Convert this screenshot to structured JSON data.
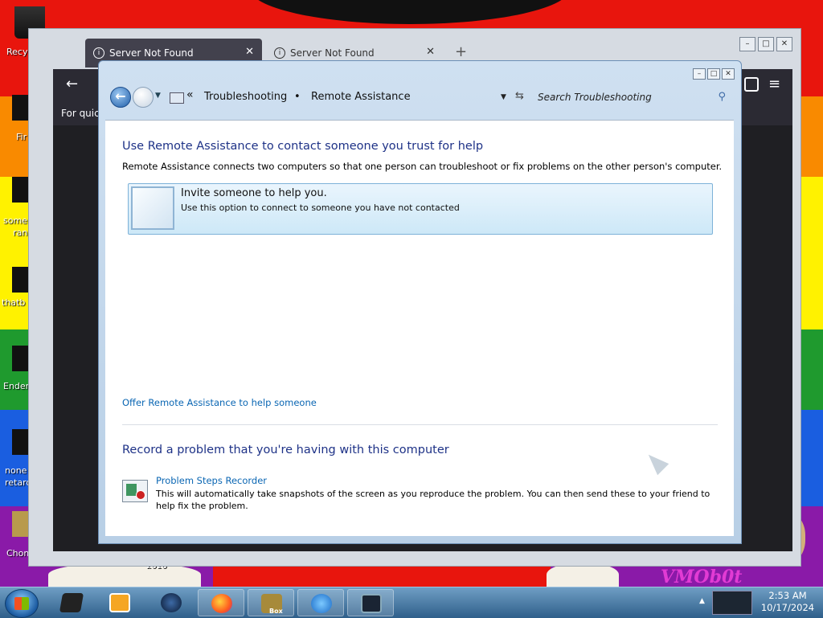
{
  "desktop": {
    "icons": [
      {
        "label": "Recy",
        "icon": "recycle-bin-icon"
      },
      {
        "label": "Fir",
        "icon": "firefox-shortcut-icon"
      },
      {
        "label": "some",
        "label2": "ran",
        "icon": "file-icon"
      },
      {
        "label": "thatb",
        "icon": "file-icon"
      },
      {
        "label": "Ender",
        "icon": "file-icon"
      },
      {
        "label": "none",
        "label2": "retard",
        "icon": "file-icon"
      },
      {
        "label": "ChomikB",
        "icon": "hamster-icon"
      }
    ],
    "wallpaper_texts": {
      "year": "2016",
      "watermark": "VMOb0t"
    }
  },
  "browser": {
    "tabs": [
      {
        "title": "Server Not Found",
        "active": true
      },
      {
        "title": "Server Not Found",
        "active": false
      }
    ],
    "quick_text": "For quick",
    "close_glyph": "✕",
    "new_tab_glyph": "+",
    "back_glyph": "←",
    "menu_glyph": "≡"
  },
  "control_panel": {
    "window_controls": {
      "minimize": "–",
      "maximize": "□",
      "close": "✕"
    },
    "breadcrumb": {
      "prefix": "«",
      "items": [
        "Troubleshooting",
        "Remote Assistance"
      ],
      "separator": "•"
    },
    "search_placeholder": "Search Troubleshooting",
    "section1": {
      "heading": "Use Remote Assistance to contact someone you trust for help",
      "description": "Remote Assistance connects two computers so that one person can troubleshoot or fix problems on the other person's computer."
    },
    "invite": {
      "title": "Invite someone to help you.",
      "subtitle": "Use this option to connect to someone you have not contacted"
    },
    "offer_link": "Offer Remote Assistance to help someone",
    "section2": {
      "heading": "Record a problem that you're having with this computer",
      "psr_link": "Problem Steps Recorder",
      "psr_desc": "This will automatically take snapshots of the screen as you reproduce the problem. You can then send these to your friend to help fix the problem."
    }
  },
  "taskbar": {
    "items": [
      "explorer-icon",
      "media-player-icon",
      "steam-icon",
      "firefox-icon",
      "hamster-box-icon",
      "internet-explorer-icon",
      "remote-assistance-icon"
    ],
    "box_label": "Box",
    "clock": {
      "time": "2:53 AM",
      "date": "10/17/2024"
    }
  },
  "colors": {
    "heading_blue": "#1e3287",
    "link_blue": "#0a66b3",
    "wallpaper_red": "#e8150d",
    "wallpaper_orange": "#f98a00",
    "wallpaper_yellow": "#fff200",
    "wallpaper_green": "#1f9a2e",
    "wallpaper_blue": "#1a5ee0",
    "wallpaper_purple": "#8a1aa8"
  }
}
